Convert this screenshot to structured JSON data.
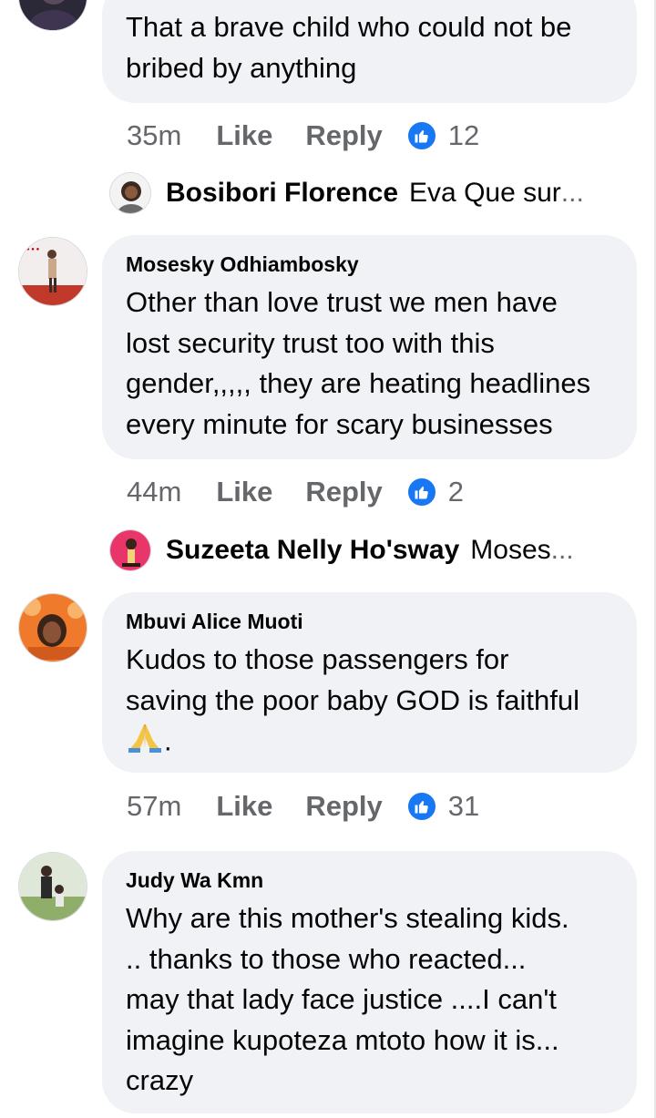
{
  "comments": [
    {
      "author": "",
      "text_lines": [
        "That a brave child who could not be",
        "bribed by anything"
      ],
      "time": "35m",
      "like_label": "Like",
      "reply_label": "Reply",
      "reactions": "12",
      "reply_preview": {
        "name": "Bosibori Florence",
        "snippet": "Eva Que sur",
        "ellipsis": "..."
      }
    },
    {
      "author": "Mosesky Odhiambosky",
      "text_lines": [
        "Other than love trust we men have",
        "lost security trust too with this",
        "gender,,,,, they are heating headlines",
        "every minute for scary businesses"
      ],
      "time": "44m",
      "like_label": "Like",
      "reply_label": "Reply",
      "reactions": "2",
      "reply_preview": {
        "name": "Suzeeta Nelly Ho'sway",
        "snippet": "Moses",
        "ellipsis": "..."
      }
    },
    {
      "author": "Mbuvi Alice Muoti",
      "text_lines": [
        "Kudos to those passengers for",
        "saving the poor baby GOD is faithful"
      ],
      "text_tail": ".",
      "time": "57m",
      "like_label": "Like",
      "reply_label": "Reply",
      "reactions": "31"
    },
    {
      "author": "Judy Wa Kmn",
      "text_lines": [
        "Why are this mother's stealing kids.",
        ".. thanks to those who reacted...",
        "may that lady face justice ....I can't",
        "imagine kupoteza mtoto how it is...",
        "crazy"
      ]
    }
  ],
  "colors": {
    "bubble": "#f0f2f5",
    "meta": "#65676b",
    "like_blue": "#1877f2",
    "text": "#050505"
  },
  "icons": {
    "reaction": "thumbs-up-icon",
    "emoji": "folded-hands-emoji"
  }
}
